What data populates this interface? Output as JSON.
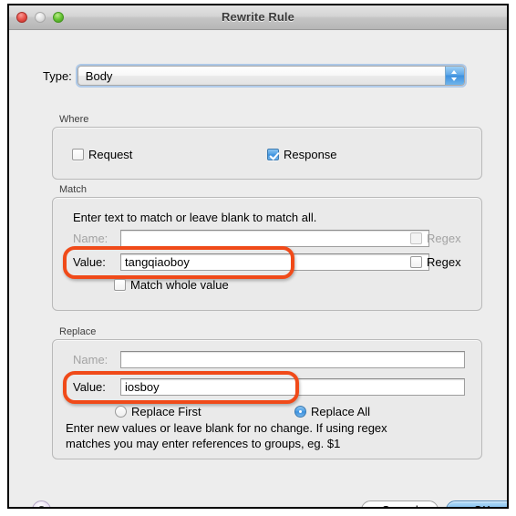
{
  "window": {
    "title": "Rewrite Rule",
    "traffic_lights": [
      "close",
      "minimize",
      "zoom"
    ]
  },
  "type_row": {
    "label": "Type:",
    "selected": "Body",
    "options": [
      "Body"
    ]
  },
  "where": {
    "group_label": "Where",
    "request": {
      "label": "Request",
      "checked": false
    },
    "response": {
      "label": "Response",
      "checked": true
    }
  },
  "match": {
    "group_label": "Match",
    "hint": "Enter text to match or leave blank to match all.",
    "name": {
      "label": "Name:",
      "value": "",
      "enabled": false
    },
    "name_regex": {
      "label": "Regex",
      "checked": false,
      "enabled": false
    },
    "value": {
      "label": "Value:",
      "value": "tangqiaoboy",
      "enabled": true
    },
    "value_regex": {
      "label": "Regex",
      "checked": false,
      "enabled": true
    },
    "match_whole": {
      "label": "Match whole value",
      "checked": false
    }
  },
  "replace": {
    "group_label": "Replace",
    "name": {
      "label": "Name:",
      "value": "",
      "enabled": false
    },
    "value": {
      "label": "Value:",
      "value": "iosboy",
      "enabled": true
    },
    "replace_first": {
      "label": "Replace First",
      "selected": false
    },
    "replace_all": {
      "label": "Replace All",
      "selected": true
    },
    "hint_line1": "Enter new values or leave blank for no change. If using regex",
    "hint_line2": "matches you may enter references to groups, eg. $1"
  },
  "footer": {
    "help": "?",
    "cancel": "Cancel",
    "ok": "OK"
  },
  "annotations": {
    "color": "#f04a19",
    "match_value_ring": "highlight around Match Value field",
    "replace_value_ring": "highlight around Replace Value field"
  }
}
